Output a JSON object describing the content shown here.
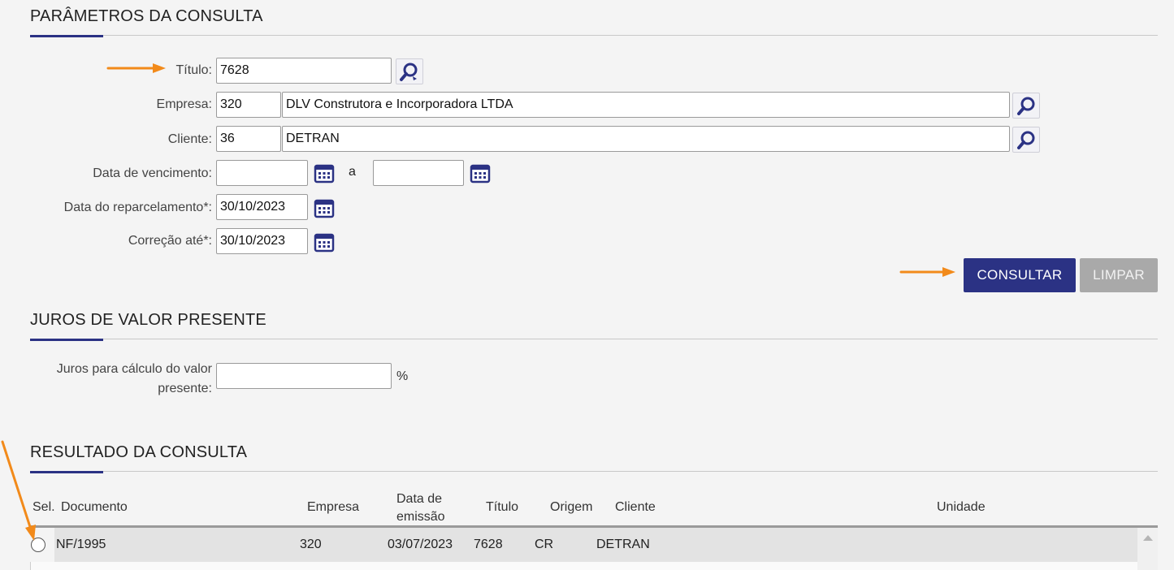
{
  "params": {
    "title": "PARÂMETROS DA CONSULTA",
    "titulo_label": "Título:",
    "titulo_value": "7628",
    "empresa_label": "Empresa:",
    "empresa_code": "320",
    "empresa_name": "DLV Construtora e Incorporadora LTDA",
    "cliente_label": "Cliente:",
    "cliente_code": "36",
    "cliente_name": "DETRAN",
    "vencimento_label": "Data de vencimento:",
    "vencimento_from": "",
    "vencimento_sep": "a",
    "vencimento_to": "",
    "reparcelamento_label": "Data do reparcelamento*:",
    "reparcelamento_value": "30/10/2023",
    "correcao_label": "Correção até*:",
    "correcao_value": "30/10/2023",
    "consultar_label": "CONSULTAR",
    "limpar_label": "LIMPAR"
  },
  "juros": {
    "title": "JUROS DE VALOR PRESENTE",
    "label_line1": "Juros para cálculo do valor",
    "label_line2": "presente:",
    "value": "",
    "unit": "%"
  },
  "results": {
    "title": "RESULTADO DA CONSULTA",
    "columns": {
      "sel": "Sel.",
      "documento": "Documento",
      "empresa": "Empresa",
      "data_line1": "Data de",
      "data_line2": "emissão",
      "titulo": "Título",
      "origem": "Origem",
      "cliente": "Cliente",
      "unidade": "Unidade"
    },
    "rows": [
      {
        "documento": "NF/1995",
        "empresa": "320",
        "data_emissao": "03/07/2023",
        "titulo": "7628",
        "origem": "CR",
        "cliente": "DETRAN",
        "unidade": ""
      }
    ]
  },
  "colors": {
    "accent": "#2b3284",
    "annotation": "#f28a1a",
    "disabled": "#a9a9a9"
  },
  "icons": [
    "search-refresh-icon",
    "search-icon",
    "calendar-icon",
    "arrow-annotation"
  ]
}
